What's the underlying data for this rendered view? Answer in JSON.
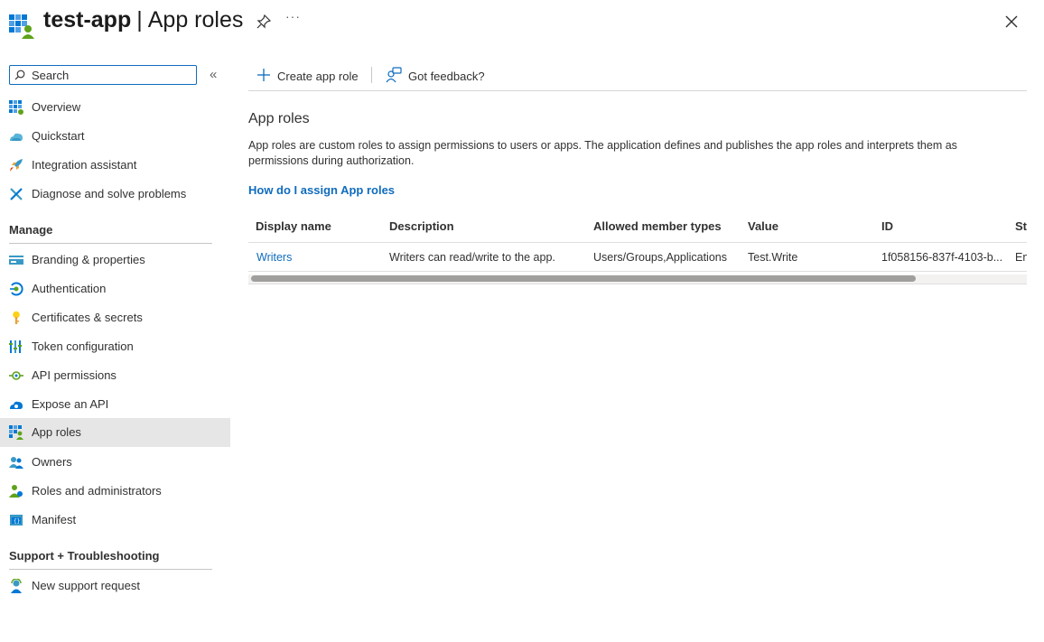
{
  "header": {
    "app_name": "test-app",
    "separator": "|",
    "page_name": "App roles",
    "more_label": "···"
  },
  "sidebar": {
    "search_placeholder": "Search",
    "collapse_glyph": "«",
    "top_items": [
      {
        "label": "Overview",
        "icon": "overview-icon"
      },
      {
        "label": "Quickstart",
        "icon": "quickstart-icon"
      },
      {
        "label": "Integration assistant",
        "icon": "rocket-icon"
      },
      {
        "label": "Diagnose and solve problems",
        "icon": "wrench-icon"
      }
    ],
    "manage_header": "Manage",
    "manage_items": [
      {
        "label": "Branding & properties",
        "icon": "branding-icon"
      },
      {
        "label": "Authentication",
        "icon": "authentication-icon"
      },
      {
        "label": "Certificates & secrets",
        "icon": "key-icon"
      },
      {
        "label": "Token configuration",
        "icon": "token-icon"
      },
      {
        "label": "API permissions",
        "icon": "api-permissions-icon"
      },
      {
        "label": "Expose an API",
        "icon": "cloud-icon"
      },
      {
        "label": "App roles",
        "icon": "app-roles-icon",
        "active": true
      },
      {
        "label": "Owners",
        "icon": "owners-icon"
      },
      {
        "label": "Roles and administrators",
        "icon": "roles-icon"
      },
      {
        "label": "Manifest",
        "icon": "manifest-icon"
      }
    ],
    "support_header": "Support + Troubleshooting",
    "support_items": [
      {
        "label": "New support request",
        "icon": "support-icon"
      }
    ]
  },
  "toolbar": {
    "create_label": "Create app role",
    "feedback_label": "Got feedback?"
  },
  "main": {
    "title": "App roles",
    "description": "App roles are custom roles to assign permissions to users or apps. The application defines and publishes the app roles and interprets them as permissions during authorization.",
    "help_link": "How do I assign App roles"
  },
  "table": {
    "columns": [
      "Display name",
      "Description",
      "Allowed member types",
      "Value",
      "ID",
      "St"
    ],
    "rows": [
      [
        "Writers",
        "Writers can read/write to the app.",
        "Users/Groups,Applications",
        "Test.Write",
        "1f058156-837f-4103-b...",
        "En"
      ]
    ],
    "scroll_fraction": 0.86
  },
  "colors": {
    "accent": "#0f6cbd",
    "active_bg": "#e6e6e6"
  }
}
